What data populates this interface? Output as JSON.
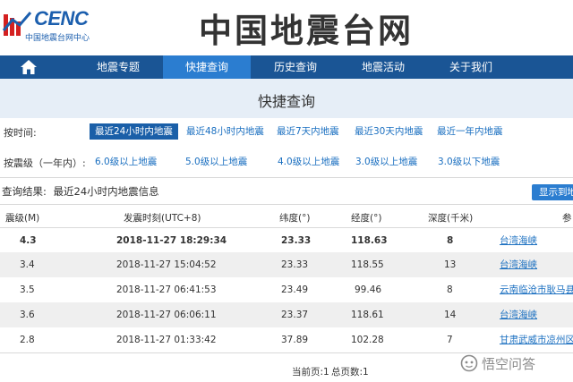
{
  "logo": {
    "text": "CENC",
    "subtitle": "中国地震台网中心"
  },
  "site_title": "中国地震台网",
  "nav": {
    "items": [
      {
        "label": "地震专题",
        "active": false
      },
      {
        "label": "快捷查询",
        "active": true
      },
      {
        "label": "历史查询",
        "active": false
      },
      {
        "label": "地震活动",
        "active": false
      },
      {
        "label": "关于我们",
        "active": false
      }
    ]
  },
  "page_title": "快捷查询",
  "filters": {
    "time": {
      "label": "按时间:",
      "options": [
        "最近24小时内地震",
        "最近48小时内地震",
        "最近7天内地震",
        "最近30天内地震",
        "最近一年内地震"
      ],
      "selected": 0
    },
    "magnitude": {
      "label": "按震级（一年内）:",
      "options": [
        "6.0级以上地震",
        "5.0级以上地震",
        "4.0级以上地震",
        "3.0级以上地震",
        "3.0级以下地震"
      ]
    }
  },
  "result": {
    "label": "查询结果:",
    "value": "最近24小时内地震信息"
  },
  "map_button": "显示到地",
  "table": {
    "headers": [
      "震级(M)",
      "发震时刻(UTC+8)",
      "纬度(°)",
      "经度(°)",
      "深度(千米)",
      "参"
    ],
    "rows": [
      {
        "mag": "4.3",
        "time": "2018-11-27 18:29:34",
        "lat": "23.33",
        "lon": "118.63",
        "depth": "8",
        "location": "台湾海峡"
      },
      {
        "mag": "3.4",
        "time": "2018-11-27 15:04:52",
        "lat": "23.33",
        "lon": "118.55",
        "depth": "13",
        "location": "台湾海峡"
      },
      {
        "mag": "3.5",
        "time": "2018-11-27 06:41:53",
        "lat": "23.49",
        "lon": "99.46",
        "depth": "8",
        "location": "云南临沧市耿马县"
      },
      {
        "mag": "3.6",
        "time": "2018-11-27 06:06:11",
        "lat": "23.37",
        "lon": "118.61",
        "depth": "14",
        "location": "台湾海峡"
      },
      {
        "mag": "2.8",
        "time": "2018-11-27 01:33:42",
        "lat": "37.89",
        "lon": "102.28",
        "depth": "7",
        "location": "甘肃武威市凉州区"
      }
    ]
  },
  "pager": {
    "current": "当前页:1",
    "total": "总页数:1"
  },
  "watermark": "悟空问答",
  "colors": {
    "brand": "#1c5fae",
    "nav_bg": "#1a5595",
    "nav_active": "#2b7dd0",
    "link": "#1a6fc0"
  }
}
